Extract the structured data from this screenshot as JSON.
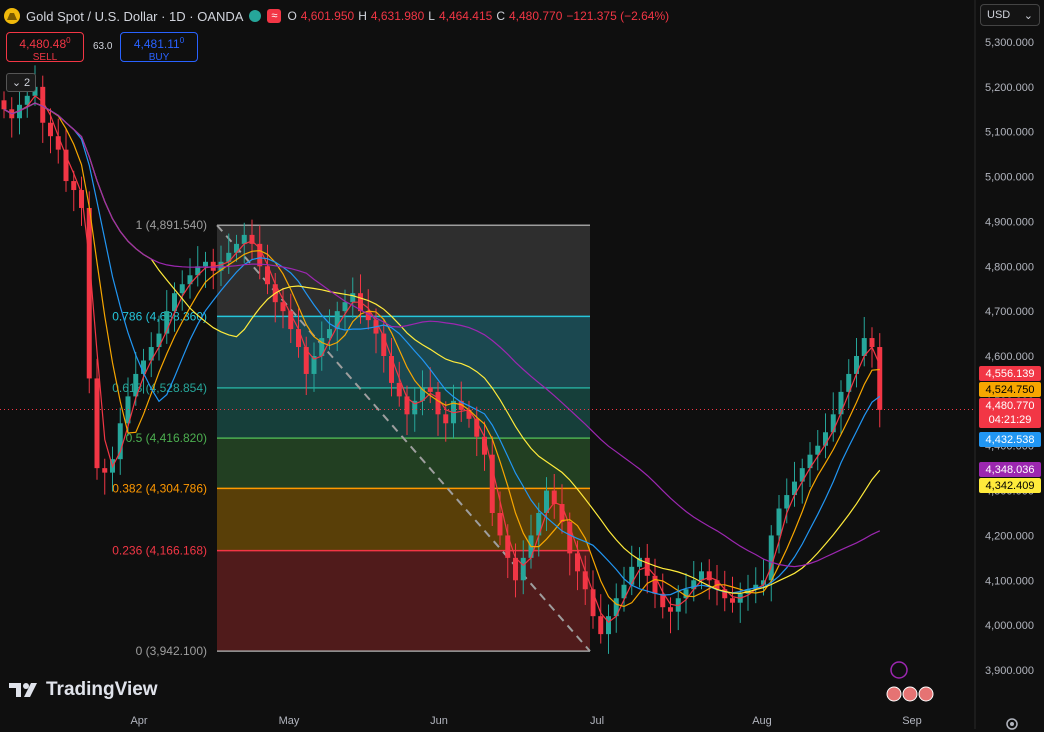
{
  "header": {
    "symbol": "Gold Spot / U.S. Dollar · 1D · OANDA",
    "open_label": "O",
    "open": "4,601.950",
    "high_label": "H",
    "high": "4,631.980",
    "low_label": "L",
    "low": "4,464.415",
    "close_label": "C",
    "close": "4,480.770",
    "change": "−121.375 (−2.64%)"
  },
  "trade": {
    "sell_price": "4,480.48",
    "sell_price_sup": "0",
    "sell_label": "SELL",
    "spread": "63.0",
    "buy_price": "4,481.11",
    "buy_price_sup": "0",
    "buy_label": "BUY"
  },
  "indicators_count": "2",
  "currency": "USD",
  "brand": "TradingView",
  "price_axis": [
    "5,300.000",
    "5,200.000",
    "5,100.000",
    "5,000.000",
    "4,900.000",
    "4,800.000",
    "4,700.000",
    "4,600.000",
    "4,500.000",
    "4,400.000",
    "4,300.000",
    "4,200.000",
    "4,100.000",
    "4,000.000",
    "3,900.000"
  ],
  "time_axis": [
    "Apr",
    "May",
    "Jun",
    "Jul",
    "Aug",
    "Sep"
  ],
  "badges": [
    {
      "value": "4,556.139",
      "color": "#f23645"
    },
    {
      "value": "4,524.750",
      "color": "#f7a600"
    },
    {
      "value": "4,480.770",
      "sub": "04:21:29",
      "color": "#f23645"
    },
    {
      "value": "4,432.538",
      "color": "#2196f3"
    },
    {
      "value": "4,348.036",
      "color": "#9c27b0"
    },
    {
      "value": "4,342.409",
      "color": "#ffeb3b"
    }
  ],
  "fib_levels": [
    {
      "ratio": "1",
      "price": "4,891.540"
    },
    {
      "ratio": "0.786",
      "price": "4,688.360"
    },
    {
      "ratio": "0.618",
      "price": "4,528.854"
    },
    {
      "ratio": "0.5",
      "price": "4,416.820"
    },
    {
      "ratio": "0.382",
      "price": "4,304.786"
    },
    {
      "ratio": "0.236",
      "price": "4,166.168"
    },
    {
      "ratio": "0",
      "price": "3,942.100"
    }
  ],
  "chart_data": {
    "type": "candlestick",
    "ylim": [
      3860,
      5340
    ],
    "grid": false,
    "closes": [
      5150,
      5130,
      5160,
      5180,
      5200,
      5120,
      5090,
      5060,
      4990,
      4970,
      4930,
      4550,
      4350,
      4340,
      4370,
      4450,
      4510,
      4560,
      4590,
      4620,
      4650,
      4700,
      4740,
      4760,
      4780,
      4800,
      4810,
      4790,
      4810,
      4830,
      4850,
      4870,
      4850,
      4800,
      4760,
      4720,
      4700,
      4660,
      4620,
      4560,
      4600,
      4640,
      4660,
      4700,
      4720,
      4740,
      4700,
      4680,
      4650,
      4600,
      4540,
      4510,
      4470,
      4500,
      4530,
      4520,
      4470,
      4450,
      4500,
      4480,
      4460,
      4420,
      4380,
      4250,
      4200,
      4150,
      4100,
      4150,
      4200,
      4250,
      4300,
      4270,
      4230,
      4160,
      4120,
      4080,
      4020,
      3980,
      4020,
      4060,
      4090,
      4130,
      4150,
      4110,
      4070,
      4040,
      4030,
      4060,
      4080,
      4100,
      4120,
      4100,
      4080,
      4060,
      4050,
      4070,
      4080,
      4090,
      4100,
      4200,
      4260,
      4290,
      4320,
      4350,
      4380,
      4400,
      4430,
      4470,
      4520,
      4560,
      4600,
      4640,
      4620,
      4480
    ]
  }
}
